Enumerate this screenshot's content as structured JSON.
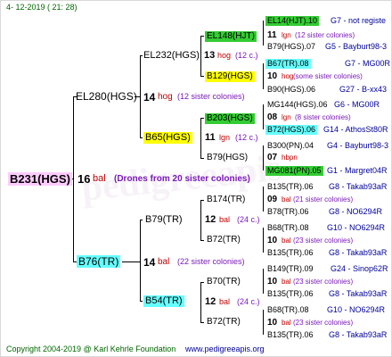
{
  "header": {
    "date": "4- 12-2019 ( 21: 28)"
  },
  "footer": {
    "copyright": "Copyright 2004-2019 @ Karl Kehrle Foundation",
    "site": "www.pedigreeapis.org"
  },
  "root": {
    "name": "B231(HGS)",
    "num": "16",
    "unit": "bal",
    "desc": "(Drones from 20 sister colonies)"
  },
  "gen1": [
    {
      "name": "EL280(HGS)",
      "num": "14",
      "unit": "hog",
      "desc": "(12 sister colonies)"
    },
    {
      "name": "B76(TR)",
      "num": "14",
      "unit": "bal",
      "desc": "(22 sister colonies)"
    }
  ],
  "gen2": [
    {
      "name": "EL232(HGS)",
      "num": "13",
      "unit": "hog",
      "desc": "(12 c.)"
    },
    {
      "name": "B65(HGS)",
      "num": "11",
      "unit": "lgn",
      "desc": "(12 c.)"
    },
    {
      "name": "B79(TR)",
      "num": "12",
      "unit": "bal",
      "desc": "(24 c.)"
    },
    {
      "name": "B54(TR)",
      "num": "12",
      "unit": "bal",
      "desc": "(24 c.)"
    }
  ],
  "gen3": [
    {
      "name": "EL148(HJT)",
      "num": "11",
      "unit": "lgn",
      "desc": "(12 sister colonies)"
    },
    {
      "name": "B129(HGS)",
      "num": "10",
      "unit": "hog",
      "desc": "(some sister colonies)"
    },
    {
      "name": "B203(HGS)",
      "num": "08",
      "unit": "lgn",
      "desc": "(8 sister colonies)"
    },
    {
      "name": "B79(HGS)",
      "num": "07",
      "unit": "hbpn",
      "desc": ""
    },
    {
      "name": "B174(TR)",
      "num": "09",
      "unit": "bal",
      "desc": "(21 sister colonies)"
    },
    {
      "name": "B72(TR)",
      "num": "10",
      "unit": "bal",
      "desc": "(23 sister colonies)"
    },
    {
      "name": "B70(TR)",
      "num": "10",
      "unit": "bal",
      "desc": "(23 sister colonies)"
    },
    {
      "name": "B72(TR)",
      "num": "10",
      "unit": "bal",
      "desc": "(23 sister colonies)"
    }
  ],
  "gen4": [
    {
      "name": "EL14(HJT).10",
      "info": "G7 - not registe"
    },
    {
      "name": "B79(HGS).07",
      "info": "G5 - Bayburt98-3"
    },
    {
      "name": "B67(TR).08",
      "info": "G7 - MG00R"
    },
    {
      "name": "B90(HGS).06",
      "info": "G27 - B-xx43"
    },
    {
      "name": "MG144(HGS).06",
      "info": "G6 - MG00R"
    },
    {
      "name": "B72(HGS).06",
      "info": "G14 - AthosSt80R"
    },
    {
      "name": "B300(PN).04",
      "info": "G4 - Bayburt98-3"
    },
    {
      "name": "MG081(PN).05",
      "info": "G1 - Margret04R"
    },
    {
      "name": "B135(TR).06",
      "info": "G8 - Takab93aR"
    },
    {
      "name": "B78(TR).06",
      "info": "G8 - NO6294R"
    },
    {
      "name": "B68(TR).08",
      "info": "G10 - NO6294R"
    },
    {
      "name": "B135(TR).06",
      "info": "G8 - Takab93aR"
    },
    {
      "name": "B149(TR).09",
      "info": "G24 - Sinop62R"
    },
    {
      "name": "B135(TR).06",
      "info": "G8 - Takab93aR"
    },
    {
      "name": "B68(TR).08",
      "info": "G10 - NO6294R"
    },
    {
      "name": "B135(TR).06",
      "info": "G8 - Takab93aR"
    }
  ],
  "colors": {
    "pink": "#ffccff",
    "green": "#33cc33",
    "cyan": "#66ffff",
    "yellow": "#ffff00",
    "teal": "#008080",
    "red": "#c00000",
    "blue": "#000099",
    "sitegreen": "#006600"
  }
}
